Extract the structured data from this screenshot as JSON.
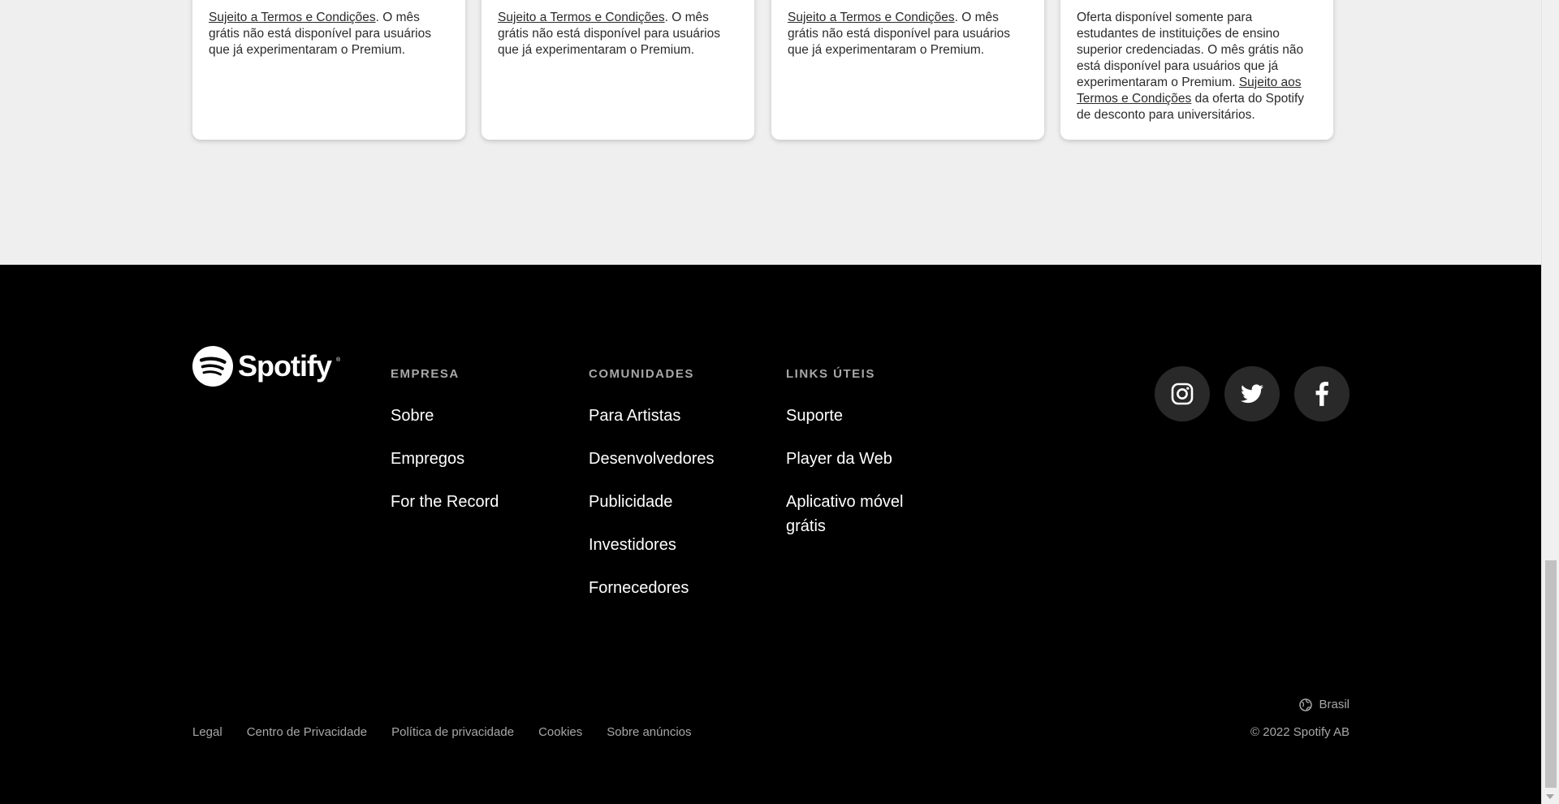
{
  "cards": [
    {
      "link": "Sujeito a Termos e Condições",
      "text": ". O mês grátis não está disponível para usuários que já experimentaram o Premium."
    },
    {
      "link": "Sujeito a Termos e Condições",
      "text": ". O mês grátis não está disponível para usuários que já experimentaram o Premium."
    },
    {
      "link": "Sujeito a Termos e Condições",
      "text": ". O mês grátis não está disponível para usuários que já experimentaram o Premium."
    },
    {
      "text_before": "Oferta disponível somente para estudantes de instituições de ensino superior credenciadas. O mês grátis não está disponível para usuários que já experimentaram o Premium. ",
      "link": "Sujeito aos Termos e Condições",
      "text_after": " da oferta do Spotify de desconto para universitários."
    }
  ],
  "footer": {
    "logo_text": "Spotify",
    "logo_reg": "®",
    "columns": [
      {
        "heading": "EMPRESA",
        "items": [
          "Sobre",
          "Empregos",
          "For the Record"
        ]
      },
      {
        "heading": "COMUNIDADES",
        "items": [
          "Para Artistas",
          "Desenvolvedores",
          "Publicidade",
          "Investidores",
          "Fornecedores"
        ]
      },
      {
        "heading": "LINKS ÚTEIS",
        "items": [
          "Suporte",
          "Player da Web",
          "Aplicativo móvel grátis"
        ]
      }
    ],
    "social": [
      "instagram-icon",
      "twitter-icon",
      "facebook-icon"
    ],
    "region": "Brasil",
    "bottom_links": [
      "Legal",
      "Centro de Privacidade",
      "Política de privacidade",
      "Cookies",
      "Sobre anúncios"
    ],
    "copyright": "© 2022 Spotify AB"
  },
  "colors": {
    "footer_bg": "#000000",
    "page_bg": "#efefef",
    "muted_text": "#a7a7a7",
    "social_bg": "#292929"
  }
}
